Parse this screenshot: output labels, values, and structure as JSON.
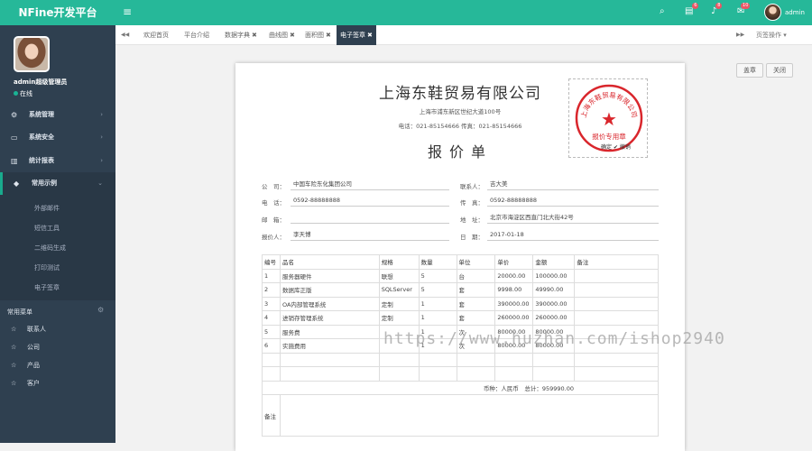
{
  "header": {
    "brand": "NFine开发平台",
    "menu_icon": "bars-icon",
    "icons": [
      {
        "name": "search-icon",
        "badge": ""
      },
      {
        "name": "envelope-icon",
        "badge": "6"
      },
      {
        "name": "bell-icon",
        "badge": "8"
      },
      {
        "name": "message-icon",
        "badge": "10"
      }
    ],
    "user": "admin"
  },
  "sidebar": {
    "username": "admin超级管理员",
    "status": "在线",
    "nav": [
      {
        "icon": "cogs-icon",
        "label": "系统管理",
        "arrow": "›"
      },
      {
        "icon": "desktop-icon",
        "label": "系统安全",
        "arrow": "›"
      },
      {
        "icon": "bar-chart-icon",
        "label": "统计报表",
        "arrow": "›"
      },
      {
        "icon": "tag-icon",
        "label": "常用示例",
        "arrow": "⌄"
      }
    ],
    "sub_items": [
      "外部邮件",
      "短信工具",
      "二维码生成",
      "打印测试",
      "电子签章"
    ],
    "quick_title": "常用菜单",
    "quick_items": [
      "联系人",
      "公司",
      "产品",
      "客户"
    ],
    "star_glyph": "☆"
  },
  "tabs": {
    "prev": "◀◀",
    "next": "▶▶",
    "items": [
      {
        "label": "欢迎首页",
        "closable": false
      },
      {
        "label": "平台介绍",
        "closable": false
      },
      {
        "label": "数据字典",
        "closable": true
      },
      {
        "label": "曲线图",
        "closable": true
      },
      {
        "label": "面积图",
        "closable": true
      },
      {
        "label": "电子签章",
        "closable": true
      }
    ],
    "close_glyph": "✖",
    "page_ops": "页签操作 ▾"
  },
  "toolbar": {
    "btn1": "盖章",
    "btn2": "关闭"
  },
  "document": {
    "company": "上海东鞋贸易有限公司",
    "address": "上海市浦东新区世纪大道100号",
    "contact": "电话：021-85154666  传真：021-85154666",
    "title": "报价单",
    "seal": {
      "arc_text": "上海东鞋贸易有限公司",
      "bottom_text": "报价专用章",
      "star": "★",
      "signature": "确定 ✔ 撤销"
    },
    "fields": {
      "company_label": "公　司：",
      "company_value": "中国车险东化集团公司",
      "contact_label": "联系人：",
      "contact_value": "吉大美",
      "phone_label": "电　话：",
      "phone_value": "0592-88888888",
      "fax_label": "传　真：",
      "fax_value": "0592-88888888",
      "email_label": "邮　箱：",
      "email_value": "",
      "address_label": "地　址：",
      "address_value": "北京市海淀区西直门北大街42号",
      "quoter_label": "报价人：",
      "quoter_value": "李天博",
      "date_label": "日　期：",
      "date_value": "2017-01-18"
    },
    "table": {
      "headers": [
        "编号",
        "品名",
        "规格",
        "数量",
        "单位",
        "单价",
        "金额",
        "备注"
      ],
      "rows": [
        [
          "1",
          "服务器硬件",
          "联想",
          "5",
          "台",
          "20000.00",
          "100000.00",
          ""
        ],
        [
          "2",
          "数据库正版",
          "SQLServer",
          "5",
          "套",
          "9998.00",
          "49990.00",
          ""
        ],
        [
          "3",
          "OA内部管理系统",
          "定制",
          "1",
          "套",
          "390000.00",
          "390000.00",
          ""
        ],
        [
          "4",
          "进销存管理系统",
          "定制",
          "1",
          "套",
          "260000.00",
          "260000.00",
          ""
        ],
        [
          "5",
          "服务费",
          "",
          "1",
          "次",
          "80000.00",
          "80000.00",
          ""
        ],
        [
          "6",
          "实施费用",
          "",
          "1",
          "次",
          "80000.00",
          "80000.00",
          ""
        ],
        [
          "",
          "",
          "",
          "",
          "",
          "",
          "",
          ""
        ],
        [
          "",
          "",
          "",
          "",
          "",
          "",
          "",
          ""
        ]
      ],
      "total": "币种：人民币　总计：959990.00",
      "remark_label": "备注"
    }
  },
  "watermark": "https://www.huzhan.com/ishop2940"
}
